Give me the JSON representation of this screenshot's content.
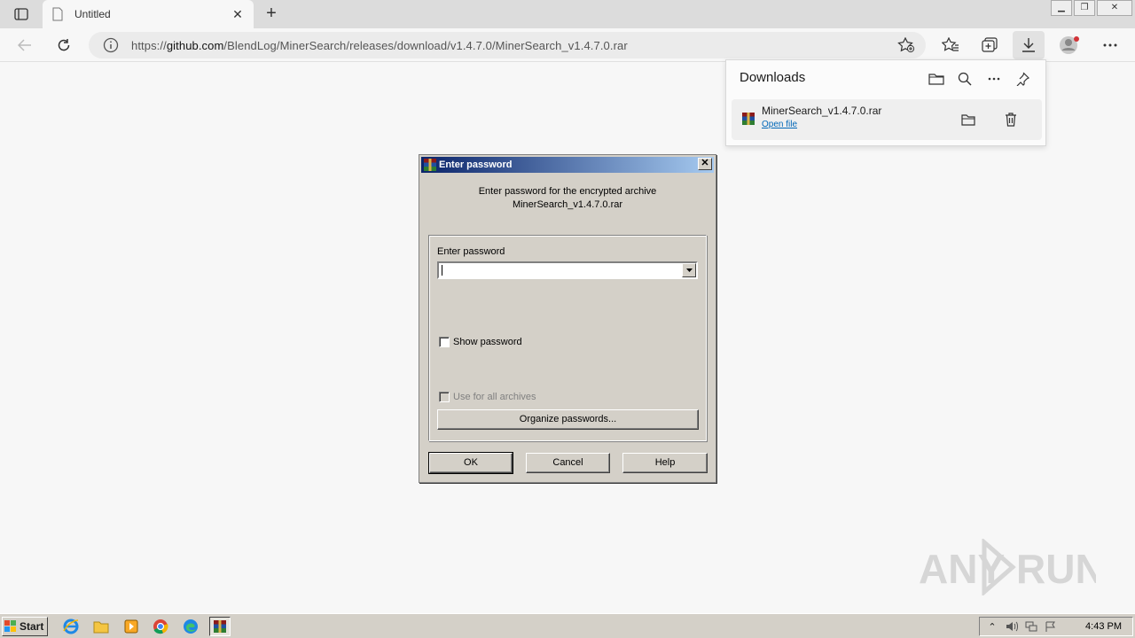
{
  "browser": {
    "tab_title": "Untitled",
    "tab_close": "✕",
    "new_tab": "+",
    "url_prefix": "https://",
    "url_host": "github.com",
    "url_path": "/BlendLog/MinerSearch/releases/download/v1.4.7.0/MinerSearch_v1.4.7.0.rar"
  },
  "downloads": {
    "title": "Downloads",
    "item_name": "MinerSearch_v1.4.7.0.rar",
    "item_action": "Open file"
  },
  "dialog": {
    "title": "Enter password",
    "message_line1": "Enter password for the encrypted archive",
    "message_line2": "MinerSearch_v1.4.7.0.rar",
    "password_label": "Enter password",
    "password_value": "",
    "show_password_label": "Show password",
    "use_all_label": "Use for all archives",
    "organize_label": "Organize passwords...",
    "ok_label": "OK",
    "cancel_label": "Cancel",
    "help_label": "Help"
  },
  "taskbar": {
    "start_label": "Start",
    "clock": "4:43 PM"
  },
  "watermark": "ANY RUN"
}
